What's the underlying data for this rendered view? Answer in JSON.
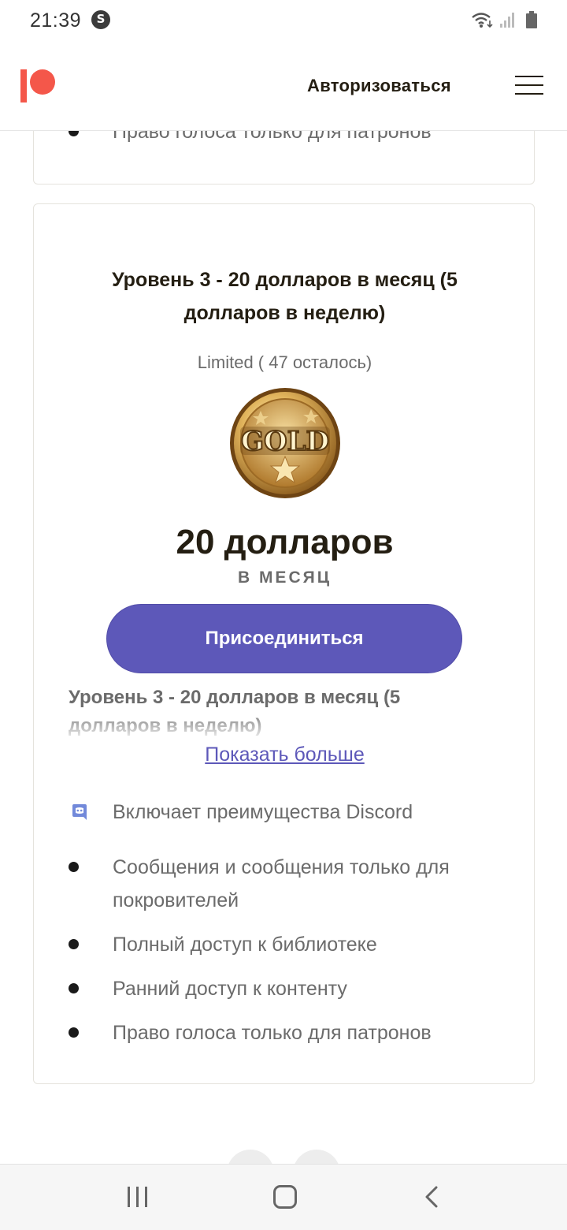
{
  "status_bar": {
    "time": "21:39",
    "icons": [
      "shazam-icon",
      "wifi-icon",
      "signal-icon",
      "battery-icon"
    ]
  },
  "header": {
    "logo": "patreon-logo",
    "login_label": "Авторизоваться",
    "menu_icon": "hamburger-menu-icon"
  },
  "previous_card": {
    "last_benefit": "Право голоса только для патронов"
  },
  "tier": {
    "title": "Уровень 3 - 20 долларов в месяц (5 долларов в неделю)",
    "limited_text": "Limited ( 47 осталось)",
    "image_label": "GOLD",
    "price": "20 долларов",
    "period": "В МЕСЯЦ",
    "join_label": "Присоединиться",
    "description": "Уровень 3 - 20 долларов в месяц (5 долларов в неделю)",
    "show_more_label": "Показать больше",
    "discord_benefit": "Включает преимущества Discord",
    "benefits": [
      "Сообщения и сообщения только для покровителей",
      "Полный доступ к библиотеке",
      "Ранний доступ к контенту",
      "Право голоса только для патронов"
    ]
  },
  "colors": {
    "brand": "#f4574a",
    "button": "#5d58b9",
    "text_dark": "#241e12",
    "text_muted": "#6b6b6b",
    "discord": "#7289da"
  },
  "nav_bar": {
    "icons": [
      "recent-apps-icon",
      "home-icon",
      "back-icon"
    ]
  }
}
